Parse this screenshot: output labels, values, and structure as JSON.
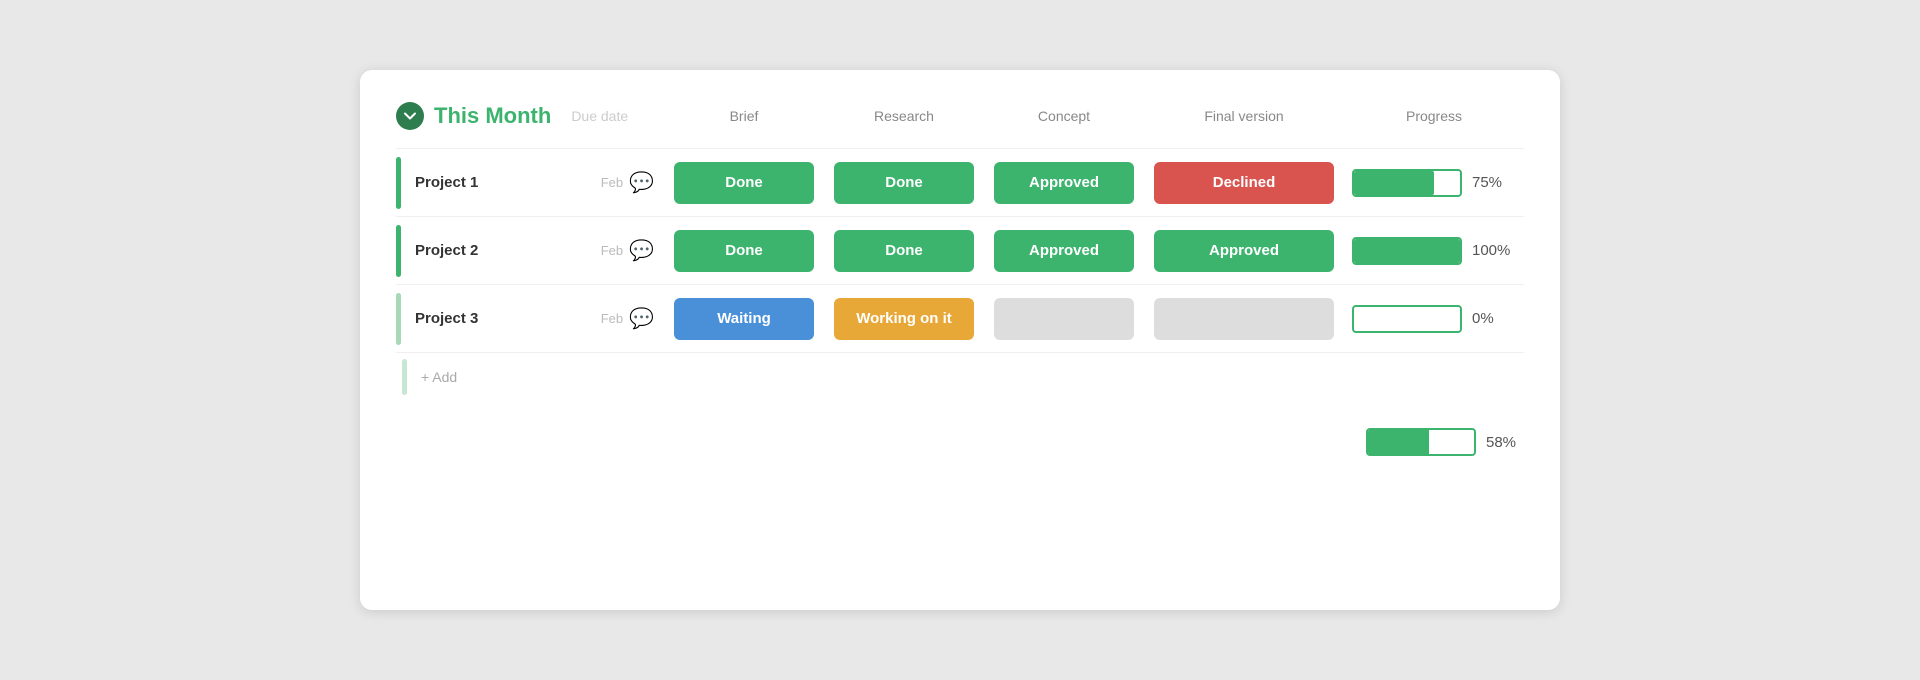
{
  "section": {
    "title": "This Month",
    "due_date_label": "Due date"
  },
  "columns": {
    "brief": "Brief",
    "research": "Research",
    "concept": "Concept",
    "final_version": "Final version",
    "progress": "Progress"
  },
  "projects": [
    {
      "name": "Project 1",
      "due": "Feb",
      "brief": {
        "label": "Done",
        "type": "green"
      },
      "research": {
        "label": "Done",
        "type": "green"
      },
      "concept": {
        "label": "Approved",
        "type": "green"
      },
      "final_version": {
        "label": "Declined",
        "type": "red"
      },
      "progress_pct": 75,
      "progress_label": "75%"
    },
    {
      "name": "Project 2",
      "due": "Feb",
      "brief": {
        "label": "Done",
        "type": "green"
      },
      "research": {
        "label": "Done",
        "type": "green"
      },
      "concept": {
        "label": "Approved",
        "type": "green"
      },
      "final_version": {
        "label": "Approved",
        "type": "green"
      },
      "progress_pct": 100,
      "progress_label": "100%"
    },
    {
      "name": "Project 3",
      "due": "Feb",
      "brief": {
        "label": "Waiting",
        "type": "blue"
      },
      "research": {
        "label": "Working on it",
        "type": "orange"
      },
      "concept": {
        "label": "",
        "type": "gray"
      },
      "final_version": {
        "label": "",
        "type": "gray"
      },
      "progress_pct": 0,
      "progress_label": "0%"
    }
  ],
  "add_label": "+ Add",
  "footer": {
    "progress_pct": 58,
    "progress_label": "58%"
  },
  "icons": {
    "chevron_down": "▾",
    "comment": "💬"
  },
  "colors": {
    "green": "#3cb46e",
    "red": "#d9534f",
    "blue": "#4a90d9",
    "orange": "#e8a838",
    "gray": "#ddd"
  }
}
